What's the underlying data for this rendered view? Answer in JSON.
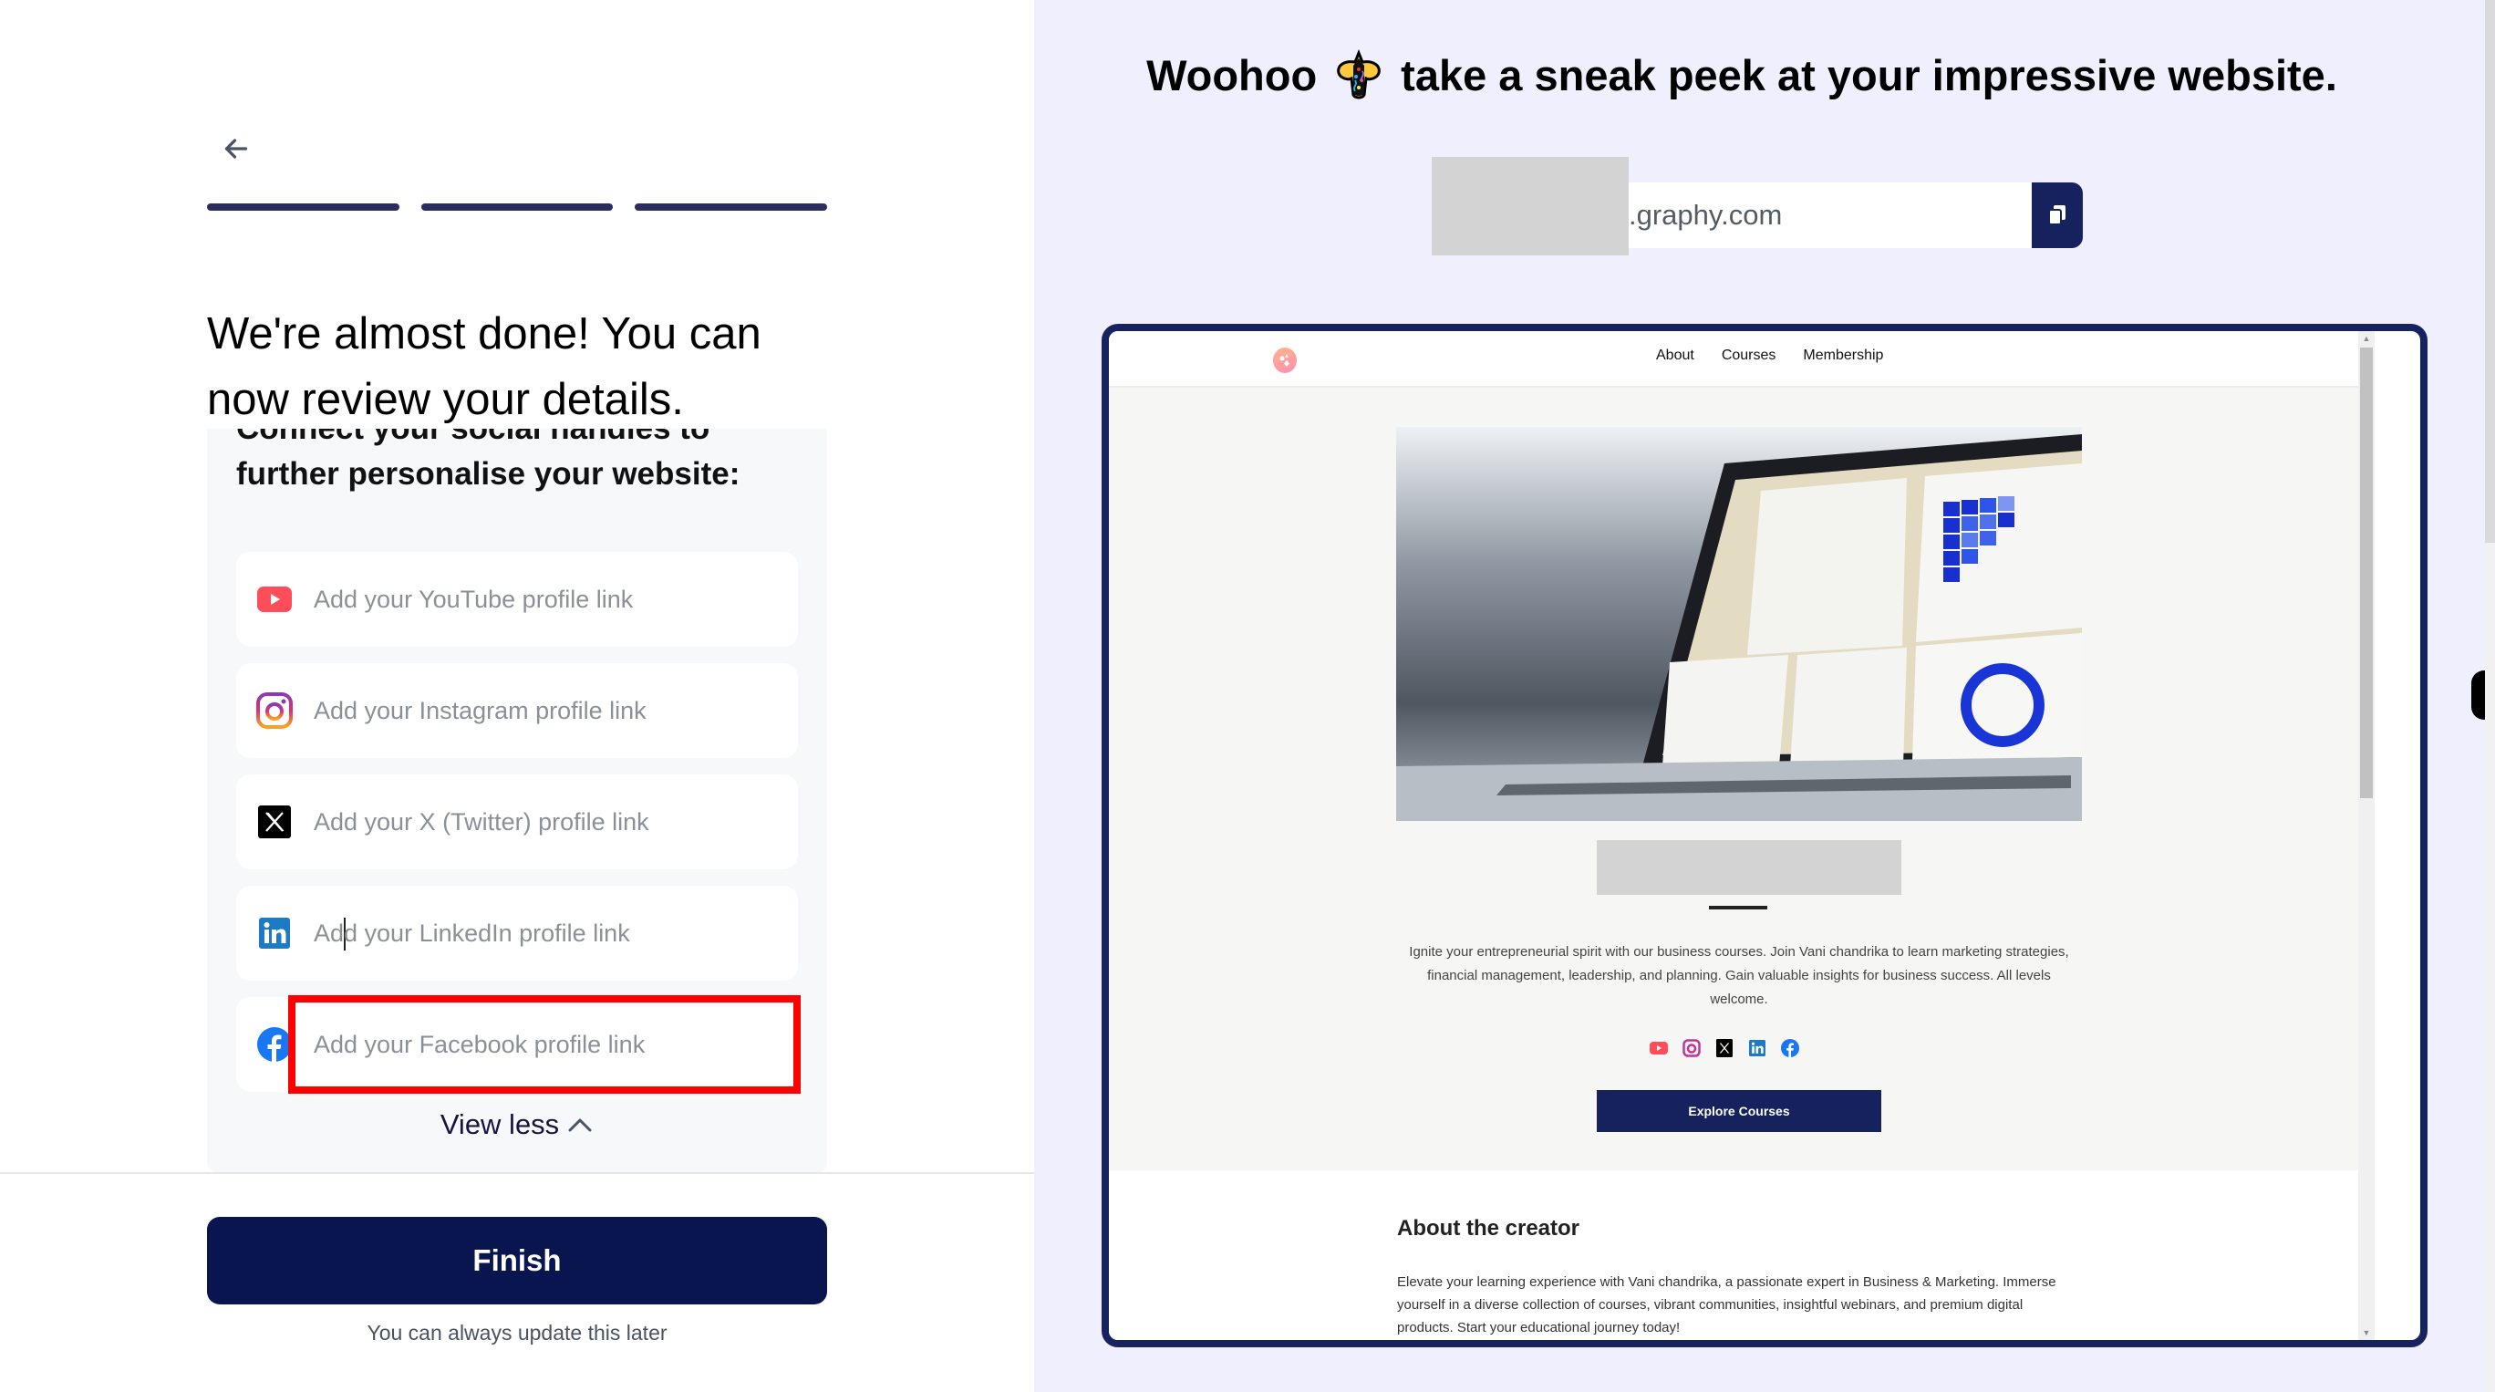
{
  "left_panel": {
    "back_label": "Back",
    "progress": {
      "completed_steps": 3,
      "total_steps": 3
    },
    "title": "We're almost done! You can now review your details.",
    "subtitle": "Connect your social handles to further personalise your website:",
    "fields": [
      {
        "network": "youtube",
        "icon": "youtube-icon",
        "placeholder": "Add your YouTube profile link",
        "value": ""
      },
      {
        "network": "instagram",
        "icon": "instagram-icon",
        "placeholder": "Add your Instagram profile link",
        "value": ""
      },
      {
        "network": "x",
        "icon": "x-twitter-icon",
        "placeholder": "Add your X (Twitter) profile link",
        "value": ""
      },
      {
        "network": "linkedin",
        "icon": "linkedin-icon",
        "placeholder": "Add your LinkedIn profile link",
        "value": ""
      },
      {
        "network": "facebook",
        "icon": "facebook-icon",
        "placeholder": "Add your Facebook profile link",
        "value": ""
      }
    ],
    "view_less_label": "View less",
    "finish_label": "Finish",
    "finish_note": "You can always update this later"
  },
  "right_panel": {
    "headline_before": "Woohoo",
    "headline_icon": "party-popper-icon",
    "headline_after": "take a sneak peek at your impressive website.",
    "url_suffix": ".graphy.com",
    "copy_icon": "copy-icon",
    "preview": {
      "nav_links": [
        "About",
        "Courses",
        "Membership"
      ],
      "bio": "Ignite your entrepreneurial spirit with our business courses. Join Vani chandrika to learn marketing strategies, financial management, leadership, and planning. Gain valuable insights for business success. All levels welcome.",
      "social_icons": [
        "youtube-icon",
        "instagram-icon",
        "x-twitter-icon",
        "linkedin-icon",
        "facebook-icon"
      ],
      "cta_label": "Explore Courses",
      "about_title": "About the creator",
      "about_text": "Elevate your learning experience with Vani chandrika, a passionate expert in Business & Marketing. Immerse yourself in a diverse collection of courses, vibrant communities, insightful webinars, and premium digital products. Start your educational journey today!"
    }
  },
  "colors": {
    "brand_navy": "#08154f",
    "progress": "#2b2d5e",
    "right_bg": "#f0effd",
    "highlight_red": "#ff0000",
    "youtube": "#ff4d5a",
    "linkedin": "#1f7ac4",
    "facebook": "#1877f2"
  }
}
